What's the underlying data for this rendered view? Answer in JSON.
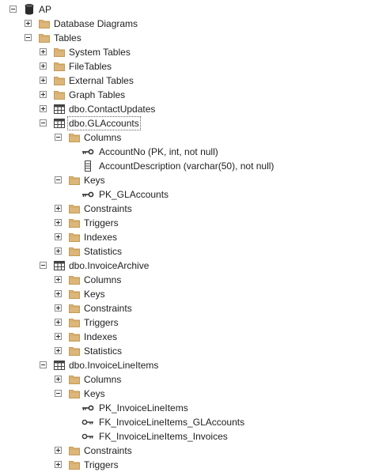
{
  "tree": [
    {
      "label": "AP",
      "icon": "database-icon",
      "expander": "expanded",
      "level": 0,
      "type": "database"
    },
    {
      "label": "Database Diagrams",
      "icon": "folder-icon",
      "expander": "collapsed",
      "level": 1,
      "type": "folder"
    },
    {
      "label": "Tables",
      "icon": "folder-icon",
      "expander": "expanded",
      "level": 1,
      "type": "folder"
    },
    {
      "label": "System Tables",
      "icon": "folder-icon",
      "expander": "collapsed",
      "level": 2,
      "type": "folder"
    },
    {
      "label": "FileTables",
      "icon": "folder-icon",
      "expander": "collapsed",
      "level": 2,
      "type": "folder"
    },
    {
      "label": "External Tables",
      "icon": "folder-icon",
      "expander": "collapsed",
      "level": 2,
      "type": "folder"
    },
    {
      "label": "Graph Tables",
      "icon": "folder-icon",
      "expander": "collapsed",
      "level": 2,
      "type": "folder"
    },
    {
      "label": "dbo.ContactUpdates",
      "icon": "table-icon",
      "expander": "collapsed",
      "level": 2,
      "type": "table"
    },
    {
      "label": "dbo.GLAccounts",
      "icon": "table-icon",
      "expander": "expanded",
      "level": 2,
      "type": "table",
      "selected": true
    },
    {
      "label": "Columns",
      "icon": "folder-icon",
      "expander": "expanded",
      "level": 3,
      "type": "folder"
    },
    {
      "label": "AccountNo (PK, int, not null)",
      "icon": "primary-key-icon",
      "expander": "none",
      "level": 4,
      "type": "column"
    },
    {
      "label": "AccountDescription (varchar(50), not null)",
      "icon": "column-icon",
      "expander": "none",
      "level": 4,
      "type": "column"
    },
    {
      "label": "Keys",
      "icon": "folder-icon",
      "expander": "expanded",
      "level": 3,
      "type": "folder"
    },
    {
      "label": "PK_GLAccounts",
      "icon": "primary-key-icon",
      "expander": "none",
      "level": 4,
      "type": "key"
    },
    {
      "label": "Constraints",
      "icon": "folder-icon",
      "expander": "collapsed",
      "level": 3,
      "type": "folder"
    },
    {
      "label": "Triggers",
      "icon": "folder-icon",
      "expander": "collapsed",
      "level": 3,
      "type": "folder"
    },
    {
      "label": "Indexes",
      "icon": "folder-icon",
      "expander": "collapsed",
      "level": 3,
      "type": "folder"
    },
    {
      "label": "Statistics",
      "icon": "folder-icon",
      "expander": "collapsed",
      "level": 3,
      "type": "folder"
    },
    {
      "label": "dbo.InvoiceArchive",
      "icon": "table-icon",
      "expander": "expanded",
      "level": 2,
      "type": "table"
    },
    {
      "label": "Columns",
      "icon": "folder-icon",
      "expander": "collapsed",
      "level": 3,
      "type": "folder"
    },
    {
      "label": "Keys",
      "icon": "folder-icon",
      "expander": "collapsed",
      "level": 3,
      "type": "folder"
    },
    {
      "label": "Constraints",
      "icon": "folder-icon",
      "expander": "collapsed",
      "level": 3,
      "type": "folder"
    },
    {
      "label": "Triggers",
      "icon": "folder-icon",
      "expander": "collapsed",
      "level": 3,
      "type": "folder"
    },
    {
      "label": "Indexes",
      "icon": "folder-icon",
      "expander": "collapsed",
      "level": 3,
      "type": "folder"
    },
    {
      "label": "Statistics",
      "icon": "folder-icon",
      "expander": "collapsed",
      "level": 3,
      "type": "folder"
    },
    {
      "label": "dbo.InvoiceLineItems",
      "icon": "table-icon",
      "expander": "expanded",
      "level": 2,
      "type": "table"
    },
    {
      "label": "Columns",
      "icon": "folder-icon",
      "expander": "collapsed",
      "level": 3,
      "type": "folder"
    },
    {
      "label": "Keys",
      "icon": "folder-icon",
      "expander": "expanded",
      "level": 3,
      "type": "folder"
    },
    {
      "label": "PK_InvoiceLineItems",
      "icon": "primary-key-icon",
      "expander": "none",
      "level": 4,
      "type": "key"
    },
    {
      "label": "FK_InvoiceLineItems_GLAccounts",
      "icon": "foreign-key-icon",
      "expander": "none",
      "level": 4,
      "type": "key"
    },
    {
      "label": "FK_InvoiceLineItems_Invoices",
      "icon": "foreign-key-icon",
      "expander": "none",
      "level": 4,
      "type": "key"
    },
    {
      "label": "Constraints",
      "icon": "folder-icon",
      "expander": "collapsed",
      "level": 3,
      "type": "folder"
    },
    {
      "label": "Triggers",
      "icon": "folder-icon",
      "expander": "collapsed",
      "level": 3,
      "type": "folder"
    }
  ],
  "colors": {
    "folder": "#dcb67a",
    "folder_dark": "#c49a54",
    "table_border": "#424242",
    "key": "#333333",
    "selection_outline": "#606060"
  }
}
